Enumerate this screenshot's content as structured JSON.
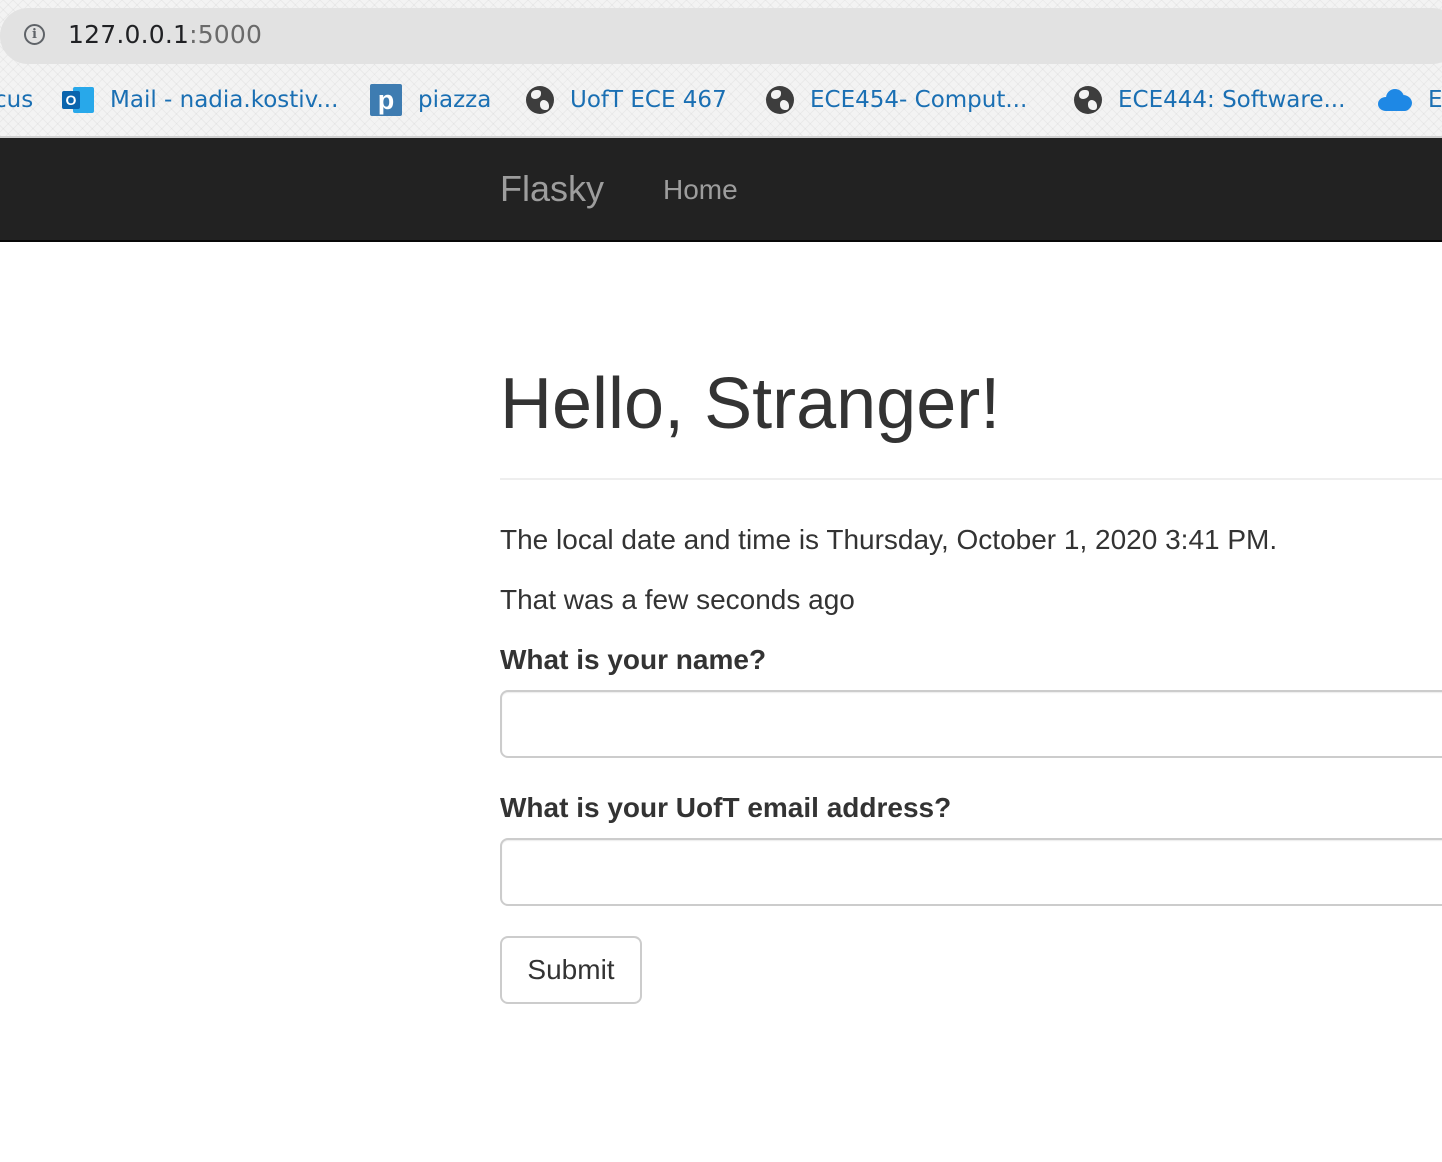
{
  "browser": {
    "url_host": "127.0.0.1",
    "url_port": ":5000",
    "info_icon": "info-icon",
    "bookmarks": [
      {
        "label": "cus",
        "icon": "none"
      },
      {
        "label": "Mail - nadia.kostiv...",
        "icon": "outlook-icon"
      },
      {
        "label": "piazza",
        "icon": "piazza-icon"
      },
      {
        "label": "UofT ECE 467",
        "icon": "globe-icon"
      },
      {
        "label": "ECE454- Comput...",
        "icon": "globe-icon"
      },
      {
        "label": "ECE444: Software...",
        "icon": "globe-icon"
      },
      {
        "label": "E",
        "icon": "onedrive-cloud-icon"
      }
    ]
  },
  "navbar": {
    "brand": "Flasky",
    "links": [
      {
        "label": "Home"
      }
    ],
    "background": "#222222",
    "link_color": "#9d9d9d"
  },
  "page": {
    "title": "Hello, Stranger!",
    "datetime_text": "The local date and time is Thursday, October 1, 2020 3:41 PM.",
    "relative_time_text": "That was a few seconds ago"
  },
  "form": {
    "name_label": "What is your name?",
    "name_value": "",
    "email_label": "What is your UofT email address?",
    "email_value": "",
    "submit_label": "Submit"
  },
  "colors": {
    "link_blue": "#1a6fb3",
    "text": "#333333",
    "input_border": "#cccccc"
  }
}
